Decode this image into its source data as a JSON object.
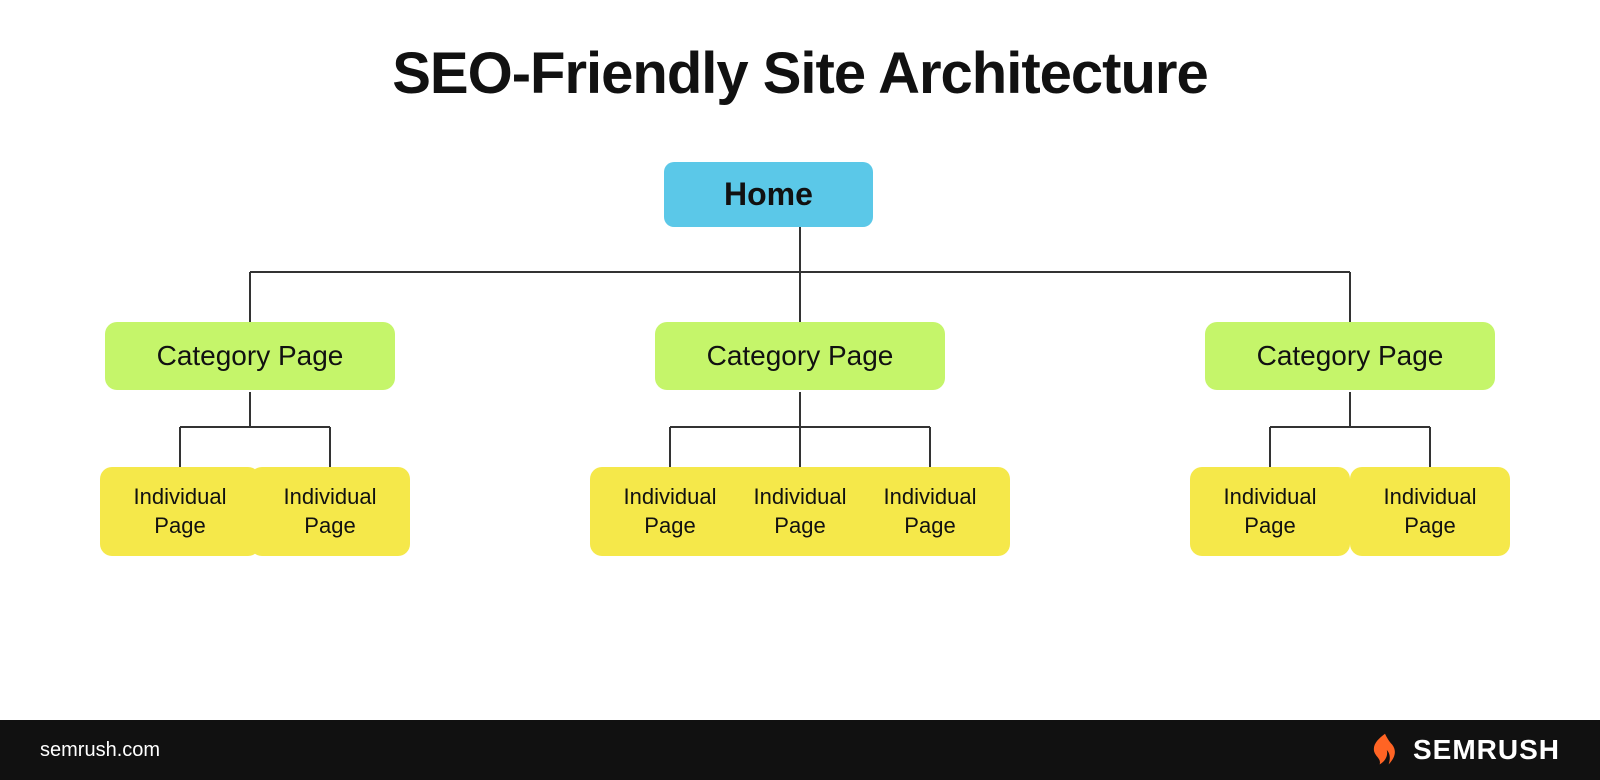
{
  "title": "SEO-Friendly Site Architecture",
  "nodes": {
    "home": {
      "label": "Home",
      "color": "#5bc8e8"
    },
    "categories": [
      {
        "label": "Category Page",
        "color": "#c5f56a"
      },
      {
        "label": "Category Page",
        "color": "#c5f56a"
      },
      {
        "label": "Category Page",
        "color": "#c5f56a"
      }
    ],
    "individuals": [
      [
        {
          "label": "Individual\nPage"
        },
        {
          "label": "Individual\nPage"
        }
      ],
      [
        {
          "label": "Individual\nPage"
        },
        {
          "label": "Individual\nPage"
        },
        {
          "label": "Individual\nPage"
        }
      ],
      [
        {
          "label": "Individual\nPage"
        },
        {
          "label": "Individual\nPage"
        }
      ]
    ]
  },
  "footer": {
    "domain": "semrush.com",
    "brand": "SEMRUSH"
  }
}
